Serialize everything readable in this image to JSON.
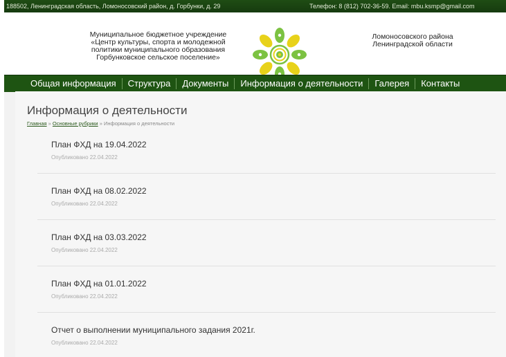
{
  "topbar": {
    "address": "188502, Ленинградская область, Ломоносовский район, д. Горбунки, д. 29",
    "contact": "Телефон: 8 (812) 702-36-59. Email: mbu.ksmp@gmail.com"
  },
  "header": {
    "org_lines": [
      "Муниципальное бюджетное учреждение",
      "«Центр культуры, спорта и молодежной",
      "политики муниципального образования",
      "Горбунковское сельское поселение»"
    ],
    "region_lines": [
      "Ломоносовского района",
      "Ленинградской области"
    ]
  },
  "nav": {
    "items": [
      {
        "label": "Общая информация"
      },
      {
        "label": "Структура"
      },
      {
        "label": "Документы"
      },
      {
        "label": "Информация о деятельности"
      },
      {
        "label": "Галерея"
      },
      {
        "label": "Контакты"
      }
    ]
  },
  "page": {
    "title": "Информация о деятельности",
    "breadcrumb": {
      "home": "Главная",
      "sep": "»",
      "section": "Основные рубрики",
      "current": "Информация о деятельности"
    }
  },
  "posts": [
    {
      "title": "План ФХД на 19.04.2022",
      "meta": "Опубликовано 22.04.2022"
    },
    {
      "title": "План ФХД на 08.02.2022",
      "meta": "Опубликовано 22.04.2022"
    },
    {
      "title": "План ФХД на 03.03.2022",
      "meta": "Опубликовано 22.04.2022"
    },
    {
      "title": "План ФХД на 01.01.2022",
      "meta": "Опубликовано 22.04.2022"
    },
    {
      "title": "Отчет о выполнении муниципального задания 2021г.",
      "meta": "Опубликовано 22.04.2022"
    }
  ],
  "colors": {
    "topbar_bg": "#1f4d14",
    "nav_bg": "#1e5412",
    "content_bg": "#f6f6f6",
    "logo_green": "#7cc242",
    "logo_yellow": "#e8d21a"
  },
  "icons": {
    "logo": "sun-leaf-logo-icon"
  }
}
